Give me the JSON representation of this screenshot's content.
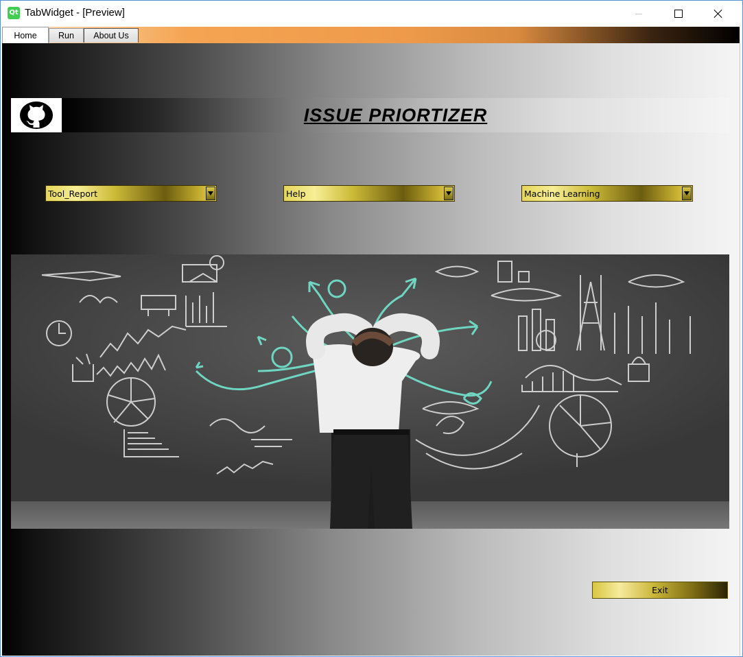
{
  "window": {
    "title": "TabWidget - [Preview]",
    "app_icon": "qt-logo-icon"
  },
  "tabs": [
    {
      "label": "Home",
      "active": true
    },
    {
      "label": "Run",
      "active": false
    },
    {
      "label": "About Us",
      "active": false
    }
  ],
  "home": {
    "logo_icon": "github-icon",
    "title": "ISSUE  PRIORTIZER",
    "dropdowns": [
      {
        "selected": "Tool_Report"
      },
      {
        "selected": "Help"
      },
      {
        "selected": "Machine Learning"
      }
    ],
    "hero_image": "person-facing-chalkboard-with-diagrams",
    "exit_label": "Exit"
  },
  "colors": {
    "tab_bar_accent": "#f5a552",
    "gold": "#cdbb38",
    "hero_chalk": "#e8e8e8",
    "hero_teal": "#6fd6c2"
  }
}
